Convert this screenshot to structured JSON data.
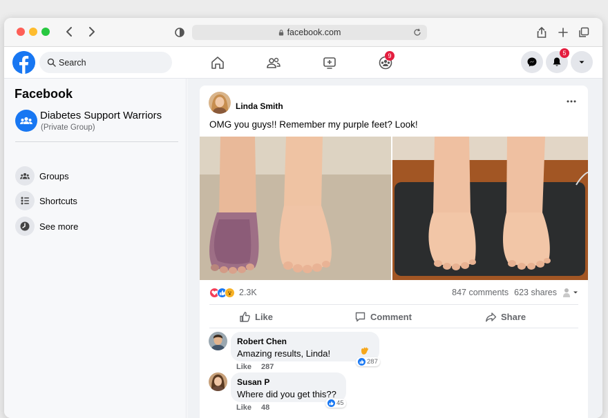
{
  "browser": {
    "url": "facebook.com",
    "back_icon": "chevron-left-icon",
    "forward_icon": "chevron-right-icon"
  },
  "topbar": {
    "search_placeholder": "Search",
    "groups_badge": "9",
    "notifications_badge": "5",
    "brand_color": "#1877f2"
  },
  "sidebar": {
    "title": "Facebook",
    "group_name": "Diabetes Support Warriors",
    "group_privacy": "(Private Group)",
    "items": [
      {
        "label": "Groups",
        "icon": "groups-icon"
      },
      {
        "label": "Shortcuts",
        "icon": "shortcuts-icon"
      },
      {
        "label": "See more",
        "icon": "see-more-icon"
      }
    ]
  },
  "post": {
    "author": "Linda Smith",
    "text": "OMG you guys!! Remember my purple feet? Look!",
    "reaction_count": "2.3K",
    "comments": "847 comments",
    "shares": "623 shares",
    "actions": {
      "like": "Like",
      "comment": "Comment",
      "share": "Share"
    }
  },
  "comments": [
    {
      "name": "Robert Chen",
      "text": "Amazing results, Linda!",
      "like_label": "Like",
      "likes": "287",
      "reaction_count": "287"
    },
    {
      "name": "Susan P",
      "text": "Where did you get this??",
      "like_label": "Like",
      "likes": "48",
      "reaction_count": "45"
    }
  ]
}
